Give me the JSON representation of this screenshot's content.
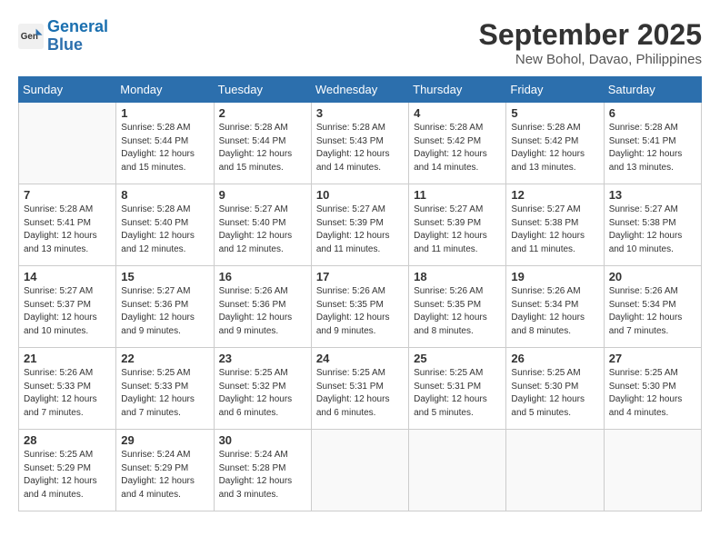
{
  "header": {
    "logo_line1": "General",
    "logo_line2": "Blue",
    "month": "September 2025",
    "location": "New Bohol, Davao, Philippines"
  },
  "weekdays": [
    "Sunday",
    "Monday",
    "Tuesday",
    "Wednesday",
    "Thursday",
    "Friday",
    "Saturday"
  ],
  "weeks": [
    [
      {
        "day": "",
        "info": ""
      },
      {
        "day": "1",
        "info": "Sunrise: 5:28 AM\nSunset: 5:44 PM\nDaylight: 12 hours\nand 15 minutes."
      },
      {
        "day": "2",
        "info": "Sunrise: 5:28 AM\nSunset: 5:44 PM\nDaylight: 12 hours\nand 15 minutes."
      },
      {
        "day": "3",
        "info": "Sunrise: 5:28 AM\nSunset: 5:43 PM\nDaylight: 12 hours\nand 14 minutes."
      },
      {
        "day": "4",
        "info": "Sunrise: 5:28 AM\nSunset: 5:42 PM\nDaylight: 12 hours\nand 14 minutes."
      },
      {
        "day": "5",
        "info": "Sunrise: 5:28 AM\nSunset: 5:42 PM\nDaylight: 12 hours\nand 13 minutes."
      },
      {
        "day": "6",
        "info": "Sunrise: 5:28 AM\nSunset: 5:41 PM\nDaylight: 12 hours\nand 13 minutes."
      }
    ],
    [
      {
        "day": "7",
        "info": "Sunrise: 5:28 AM\nSunset: 5:41 PM\nDaylight: 12 hours\nand 13 minutes."
      },
      {
        "day": "8",
        "info": "Sunrise: 5:28 AM\nSunset: 5:40 PM\nDaylight: 12 hours\nand 12 minutes."
      },
      {
        "day": "9",
        "info": "Sunrise: 5:27 AM\nSunset: 5:40 PM\nDaylight: 12 hours\nand 12 minutes."
      },
      {
        "day": "10",
        "info": "Sunrise: 5:27 AM\nSunset: 5:39 PM\nDaylight: 12 hours\nand 11 minutes."
      },
      {
        "day": "11",
        "info": "Sunrise: 5:27 AM\nSunset: 5:39 PM\nDaylight: 12 hours\nand 11 minutes."
      },
      {
        "day": "12",
        "info": "Sunrise: 5:27 AM\nSunset: 5:38 PM\nDaylight: 12 hours\nand 11 minutes."
      },
      {
        "day": "13",
        "info": "Sunrise: 5:27 AM\nSunset: 5:38 PM\nDaylight: 12 hours\nand 10 minutes."
      }
    ],
    [
      {
        "day": "14",
        "info": "Sunrise: 5:27 AM\nSunset: 5:37 PM\nDaylight: 12 hours\nand 10 minutes."
      },
      {
        "day": "15",
        "info": "Sunrise: 5:27 AM\nSunset: 5:36 PM\nDaylight: 12 hours\nand 9 minutes."
      },
      {
        "day": "16",
        "info": "Sunrise: 5:26 AM\nSunset: 5:36 PM\nDaylight: 12 hours\nand 9 minutes."
      },
      {
        "day": "17",
        "info": "Sunrise: 5:26 AM\nSunset: 5:35 PM\nDaylight: 12 hours\nand 9 minutes."
      },
      {
        "day": "18",
        "info": "Sunrise: 5:26 AM\nSunset: 5:35 PM\nDaylight: 12 hours\nand 8 minutes."
      },
      {
        "day": "19",
        "info": "Sunrise: 5:26 AM\nSunset: 5:34 PM\nDaylight: 12 hours\nand 8 minutes."
      },
      {
        "day": "20",
        "info": "Sunrise: 5:26 AM\nSunset: 5:34 PM\nDaylight: 12 hours\nand 7 minutes."
      }
    ],
    [
      {
        "day": "21",
        "info": "Sunrise: 5:26 AM\nSunset: 5:33 PM\nDaylight: 12 hours\nand 7 minutes."
      },
      {
        "day": "22",
        "info": "Sunrise: 5:25 AM\nSunset: 5:33 PM\nDaylight: 12 hours\nand 7 minutes."
      },
      {
        "day": "23",
        "info": "Sunrise: 5:25 AM\nSunset: 5:32 PM\nDaylight: 12 hours\nand 6 minutes."
      },
      {
        "day": "24",
        "info": "Sunrise: 5:25 AM\nSunset: 5:31 PM\nDaylight: 12 hours\nand 6 minutes."
      },
      {
        "day": "25",
        "info": "Sunrise: 5:25 AM\nSunset: 5:31 PM\nDaylight: 12 hours\nand 5 minutes."
      },
      {
        "day": "26",
        "info": "Sunrise: 5:25 AM\nSunset: 5:30 PM\nDaylight: 12 hours\nand 5 minutes."
      },
      {
        "day": "27",
        "info": "Sunrise: 5:25 AM\nSunset: 5:30 PM\nDaylight: 12 hours\nand 4 minutes."
      }
    ],
    [
      {
        "day": "28",
        "info": "Sunrise: 5:25 AM\nSunset: 5:29 PM\nDaylight: 12 hours\nand 4 minutes."
      },
      {
        "day": "29",
        "info": "Sunrise: 5:24 AM\nSunset: 5:29 PM\nDaylight: 12 hours\nand 4 minutes."
      },
      {
        "day": "30",
        "info": "Sunrise: 5:24 AM\nSunset: 5:28 PM\nDaylight: 12 hours\nand 3 minutes."
      },
      {
        "day": "",
        "info": ""
      },
      {
        "day": "",
        "info": ""
      },
      {
        "day": "",
        "info": ""
      },
      {
        "day": "",
        "info": ""
      }
    ]
  ]
}
